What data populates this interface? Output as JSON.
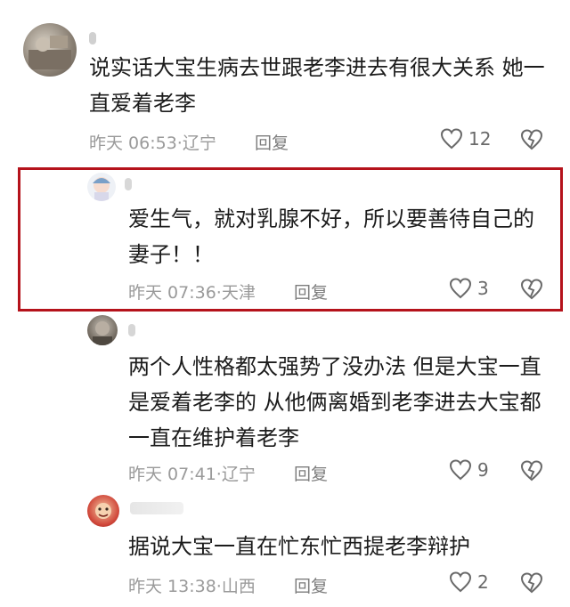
{
  "comments": [
    {
      "text": "说实话大宝生病去世跟老李进去有很大关系 她一\n直爱着老李",
      "time": "昨天 06:53",
      "sep": "·",
      "location": "辽宁",
      "reply_label": "回复",
      "likes": "12"
    },
    {
      "text": "爱生气，就对乳腺不好，所以要善待自己的\n妻子！！",
      "time": "昨天 07:36",
      "sep": "·",
      "location": "天津",
      "reply_label": "回复",
      "likes": "3"
    },
    {
      "text": "两个人性格都太强势了没办法 但是大宝一直\n是爱着老李的 从他俩离婚到老李进去大宝都\n一直在维护着老李",
      "time": "昨天 07:41",
      "sep": "·",
      "location": "辽宁",
      "reply_label": "回复",
      "likes": "9"
    },
    {
      "text": "据说大宝一直在忙东忙西提老李辩护",
      "time": "昨天 13:38",
      "sep": "·",
      "location": "山西",
      "reply_label": "回复",
      "likes": "2"
    }
  ],
  "icons": {
    "like": "heart-outline-icon",
    "dislike": "broken-heart-icon"
  },
  "colors": {
    "highlight_border": "#b5121b",
    "meta_text": "#9a9a9a"
  }
}
